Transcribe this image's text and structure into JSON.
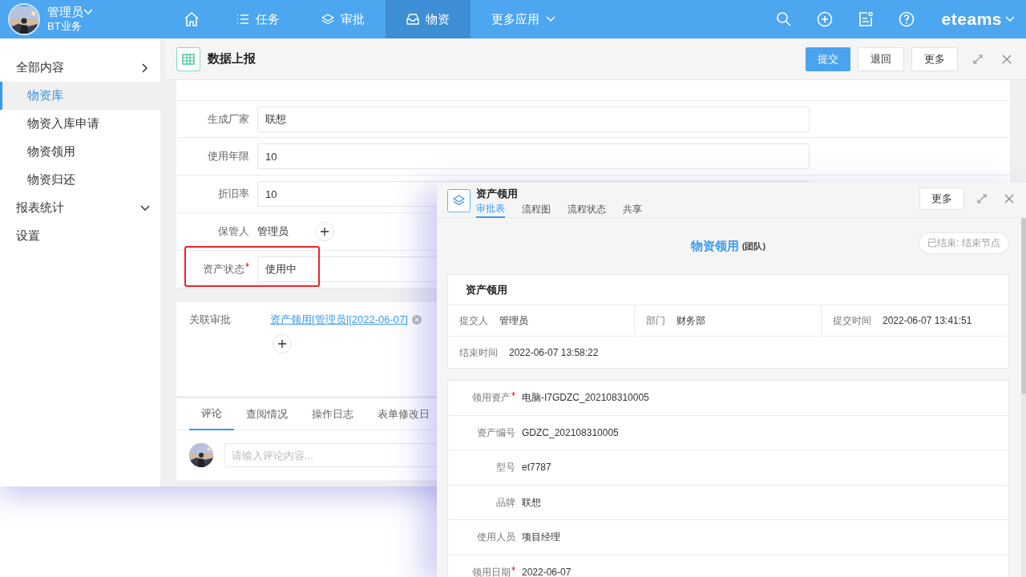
{
  "top_bar": {
    "user": {
      "name": "管理员",
      "team": "BT业务"
    },
    "nav": [
      {
        "kind": "home",
        "selected": false
      },
      {
        "kind": "list",
        "label": "任务",
        "selected": false
      },
      {
        "kind": "layers",
        "label": "审批",
        "selected": false
      },
      {
        "kind": "tray",
        "label": "物资",
        "selected": true
      },
      {
        "kind": "menu",
        "label": "更多应用",
        "selected": false
      }
    ],
    "brand": "eteams"
  },
  "sidebar": {
    "items": [
      {
        "label": "全部内容",
        "expanded": false,
        "children": [
          {
            "label": "物资库",
            "selected": true
          },
          {
            "label": "物资入库申请",
            "selected": false
          },
          {
            "label": "物资领用",
            "selected": false
          },
          {
            "label": "物资归还",
            "selected": false
          }
        ]
      },
      {
        "label": "报表统计",
        "expanded": true
      },
      {
        "label": "设置"
      }
    ]
  },
  "page": {
    "title": "数据上报",
    "actions": [
      {
        "label": "提交",
        "primary": true
      },
      {
        "label": "退回",
        "primary": false
      },
      {
        "label": "更多",
        "primary": false
      }
    ],
    "form_rows": [
      {
        "kind": "input",
        "label": "生成厂家",
        "value": "联想",
        "required": false,
        "highlighted": false
      },
      {
        "kind": "input",
        "label": "使用年限",
        "value": "10",
        "required": false,
        "highlighted": false
      },
      {
        "kind": "input",
        "label": "折旧率",
        "value": "10",
        "required": false,
        "highlighted": false
      },
      {
        "kind": "person",
        "label": "保管人",
        "value": "管理员",
        "required": false,
        "highlighted": false
      },
      {
        "kind": "input",
        "label": "资产状态",
        "value": "使用中",
        "required": true,
        "highlighted": true
      }
    ],
    "related": {
      "label": "关联审批",
      "link": "资产领用[管理员][2022-06-07]"
    },
    "comment_tabs": [
      {
        "label": "评论",
        "selected": true
      },
      {
        "label": "查阅情况",
        "selected": false
      },
      {
        "label": "操作日志",
        "selected": false
      },
      {
        "label": "表单修改日",
        "selected": false
      }
    ],
    "comment_box": {
      "placeholder": "请输入评论内容..."
    }
  },
  "dialog": {
    "title": "资产领用",
    "tabs": [
      {
        "label": "审批表",
        "selected": true
      },
      {
        "label": "流程图",
        "selected": false
      },
      {
        "label": "流程状态",
        "selected": false
      },
      {
        "label": "共享",
        "selected": false
      }
    ],
    "more_button": "更多",
    "form_title": "物资领用",
    "form_team": "(团队)",
    "status": "已结束: 结束节点",
    "section_title": "资产领用",
    "meta": [
      {
        "label": "提交人",
        "value": "管理员"
      },
      {
        "label": "部门",
        "value": "财务部"
      },
      {
        "label": "提交时间",
        "value": "2022-06-07 13:41:51"
      },
      {
        "label": "结束时间",
        "value": "2022-06-07 13:58:22"
      }
    ],
    "fields": [
      {
        "label": "领用资产",
        "value": "电脑-I7GDZC_202108310005",
        "required": true
      },
      {
        "label": "资产编号",
        "value": "GDZC_202108310005",
        "required": false
      },
      {
        "label": "型号",
        "value": "et7787",
        "required": false
      },
      {
        "label": "品牌",
        "value": "联想",
        "required": false
      },
      {
        "label": "使用人员",
        "value": "项目经理",
        "required": false
      },
      {
        "label": "领用日期",
        "value": "2022-06-07",
        "required": true
      }
    ]
  }
}
